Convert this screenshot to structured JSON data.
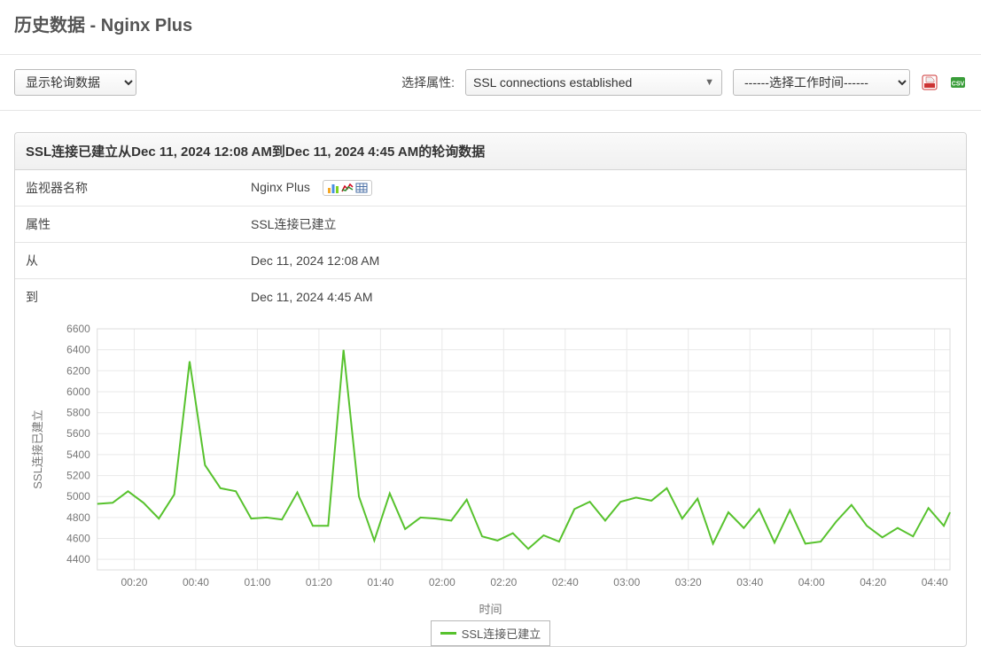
{
  "header": {
    "title": "历史数据 - Nginx Plus"
  },
  "toolbar": {
    "data_select_label": "显示轮询数据",
    "attr_label": "选择属性:",
    "attr_value": "SSL connections established",
    "work_time_label": "------选择工作时间------"
  },
  "panel": {
    "title": "SSL连接已建立从Dec 11, 2024 12:08 AM到Dec 11, 2024 4:45 AM的轮询数据",
    "rows": {
      "monitor_label": "监视器名称",
      "monitor_value": "Nginx Plus",
      "attr_label": "属性",
      "attr_value": "SSL连接已建立",
      "from_label": "从",
      "from_value": "Dec 11, 2024 12:08 AM",
      "to_label": "到",
      "to_value": "Dec 11, 2024 4:45 AM"
    }
  },
  "chart": {
    "y_axis_title": "SSL连接已建立",
    "x_axis_title": "时间",
    "legend": "SSL连接已建立"
  },
  "chart_data": {
    "type": "line",
    "title": "SSL连接已建立从Dec 11, 2024 12:08 AM到Dec 11, 2024 4:45 AM的轮询数据",
    "xlabel": "时间",
    "ylabel": "SSL连接已建立",
    "ylim": [
      4300,
      6600
    ],
    "y_ticks": [
      4400,
      4600,
      4800,
      5000,
      5200,
      5400,
      5600,
      5800,
      6000,
      6200,
      6400,
      6600
    ],
    "x_ticks": [
      "00:20",
      "00:40",
      "01:00",
      "01:20",
      "01:40",
      "02:00",
      "02:20",
      "02:40",
      "03:00",
      "03:20",
      "03:40",
      "04:00",
      "04:20",
      "04:40"
    ],
    "series": [
      {
        "name": "SSL连接已建立",
        "color": "#57c22d",
        "x": [
          "00:08",
          "00:13",
          "00:18",
          "00:23",
          "00:28",
          "00:33",
          "00:38",
          "00:43",
          "00:48",
          "00:53",
          "00:58",
          "01:03",
          "01:08",
          "01:13",
          "01:18",
          "01:23",
          "01:28",
          "01:33",
          "01:38",
          "01:43",
          "01:48",
          "01:53",
          "01:58",
          "02:03",
          "02:08",
          "02:13",
          "02:18",
          "02:23",
          "02:28",
          "02:33",
          "02:38",
          "02:43",
          "02:48",
          "02:53",
          "02:58",
          "03:03",
          "03:08",
          "03:13",
          "03:18",
          "03:23",
          "03:28",
          "03:33",
          "03:38",
          "03:43",
          "03:48",
          "03:53",
          "03:58",
          "04:03",
          "04:08",
          "04:13",
          "04:18",
          "04:23",
          "04:28",
          "04:33",
          "04:38",
          "04:43",
          "04:45"
        ],
        "values": [
          4930,
          4940,
          5050,
          4940,
          4790,
          5020,
          6290,
          5300,
          5080,
          5050,
          4790,
          4800,
          4780,
          5040,
          4720,
          4720,
          6400,
          5000,
          4580,
          5030,
          4690,
          4800,
          4790,
          4770,
          4970,
          4620,
          4580,
          4650,
          4500,
          4630,
          4570,
          4880,
          4950,
          4770,
          4950,
          4990,
          4960,
          5080,
          4790,
          4980,
          4550,
          4850,
          4700,
          4880,
          4560,
          4870,
          4550,
          4570,
          4760,
          4920,
          4720,
          4610,
          4700,
          4620,
          4890,
          4720,
          4850
        ]
      }
    ]
  }
}
